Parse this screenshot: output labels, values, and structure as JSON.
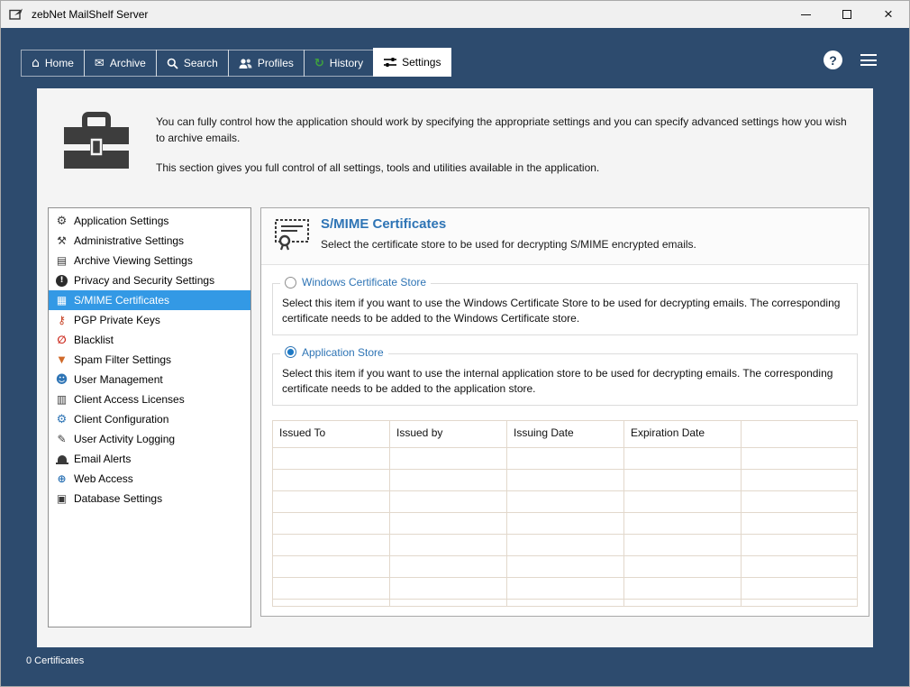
{
  "window": {
    "title": "zebNet MailShelf Server",
    "controls": [
      "minimize",
      "maximize",
      "close"
    ]
  },
  "tabs": [
    {
      "label": "Home",
      "icon": "home",
      "active": false
    },
    {
      "label": "Archive",
      "icon": "envelope",
      "active": false
    },
    {
      "label": "Search",
      "icon": "magnifier",
      "active": false
    },
    {
      "label": "Profiles",
      "icon": "people",
      "active": false
    },
    {
      "label": "History",
      "icon": "history-arrow",
      "active": false
    },
    {
      "label": "Settings",
      "icon": "sliders",
      "active": true
    }
  ],
  "topbar": {
    "help_icon": "help-question",
    "menu_icon": "hamburger"
  },
  "header": {
    "icon": "toolbox",
    "paragraph1": "You can fully control how the application should work by specifying the appropriate settings and you can specify advanced settings how you wish to archive emails.",
    "paragraph2": "This section gives you full control of all settings, tools and utilities available in the application."
  },
  "sidebar": {
    "items": [
      {
        "label": "Application Settings",
        "icon": "gear",
        "selected": false
      },
      {
        "label": "Administrative Settings",
        "icon": "tools",
        "selected": false
      },
      {
        "label": "Archive Viewing Settings",
        "icon": "document",
        "selected": false
      },
      {
        "label": "Privacy and Security Settings",
        "icon": "privacy-exclamation",
        "selected": false
      },
      {
        "label": "S/MIME Certificates",
        "icon": "certificate",
        "selected": true
      },
      {
        "label": "PGP Private Keys",
        "icon": "key",
        "selected": false
      },
      {
        "label": "Blacklist",
        "icon": "blocked",
        "selected": false
      },
      {
        "label": "Spam Filter Settings",
        "icon": "filter",
        "selected": false
      },
      {
        "label": "User Management",
        "icon": "user",
        "selected": false
      },
      {
        "label": "Client Access Licenses",
        "icon": "license",
        "selected": false
      },
      {
        "label": "Client Configuration",
        "icon": "client-config",
        "selected": false
      },
      {
        "label": "User Activity Logging",
        "icon": "pencil-log",
        "selected": false
      },
      {
        "label": "Email Alerts",
        "icon": "bell",
        "selected": false
      },
      {
        "label": "Web Access",
        "icon": "globe",
        "selected": false
      },
      {
        "label": "Database Settings",
        "icon": "database",
        "selected": false
      }
    ]
  },
  "main": {
    "icon": "certificate-seal",
    "title": "S/MIME Certificates",
    "subtitle": "Select the certificate store to be used for decrypting S/MIME encrypted emails.",
    "options": [
      {
        "label": "Windows Certificate Store",
        "selected": false,
        "description": "Select this item if you want to use the Windows Certificate Store to be used for decrypting emails. The corresponding certificate needs to be added to the Windows Certificate store."
      },
      {
        "label": "Application Store",
        "selected": true,
        "description": "Select this item if you want to use the internal application store to be used for decrypting emails. The corresponding certificate needs to be added to the application store."
      }
    ],
    "table": {
      "columns": [
        "Issued To",
        "Issued by",
        "Issuing Date",
        "Expiration Date"
      ],
      "rows": []
    }
  },
  "statusbar": {
    "text": "0 Certificates"
  },
  "colors": {
    "navy": "#2d4b6e",
    "selection_blue": "#3399e5",
    "heading_blue": "#2e74b5",
    "grid_line": "#e2d8cc",
    "danger_red": "#cc2a1e"
  }
}
